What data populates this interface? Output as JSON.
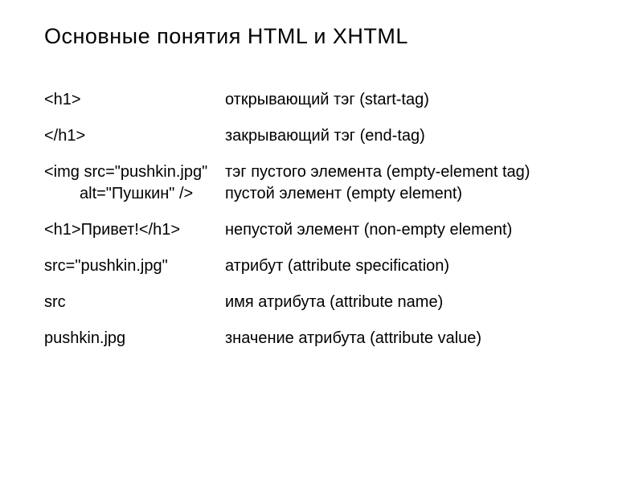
{
  "title": "Основные понятия HTML и XHTML",
  "rows": [
    {
      "left": "<h1>",
      "right": "открывающий тэг (start-tag)"
    },
    {
      "left": "</h1>",
      "right": "закрывающий тэг (end-tag)"
    },
    {
      "left": "<img src=\"pushkin.jpg\"",
      "left2": "alt=\"Пушкин\" />",
      "right": "тэг пустого элемента (empty-element tag)",
      "right2": "пустой элемент (empty element)"
    },
    {
      "left": "<h1>Привет!</h1>",
      "right": "непустой элемент (non-empty element)"
    },
    {
      "left": "src=\"pushkin.jpg\"",
      "right": "атрибут (attribute specification)"
    },
    {
      "left": "src",
      "right": "имя атрибута (attribute name)"
    },
    {
      "left": "pushkin.jpg",
      "right": "значение атрибута (attribute value)"
    }
  ]
}
